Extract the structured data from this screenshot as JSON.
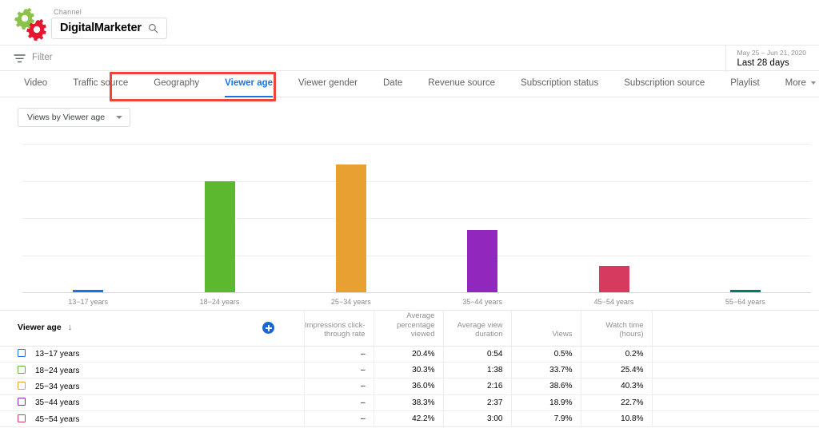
{
  "header": {
    "logo_icon": "gears-logo-icon",
    "logo_colors": {
      "gear_green": "#8bc34a",
      "gear_red": "#e3172f"
    },
    "channel_label": "Channel",
    "channel_name": "DigitalMarketer",
    "search_icon": "search-icon"
  },
  "filterbar": {
    "filter_icon": "filter-icon",
    "filter_placeholder": "Filter",
    "date_range": "May 25 – Jun 21, 2020",
    "date_preset": "Last 28 days"
  },
  "tabs": {
    "items": [
      {
        "label": "Video",
        "active": false
      },
      {
        "label": "Traffic source",
        "active": false
      },
      {
        "label": "Geography",
        "active": false
      },
      {
        "label": "Viewer age",
        "active": true
      },
      {
        "label": "Viewer gender",
        "active": false
      },
      {
        "label": "Date",
        "active": false
      },
      {
        "label": "Revenue source",
        "active": false
      },
      {
        "label": "Subscription status",
        "active": false
      },
      {
        "label": "Subscription source",
        "active": false
      },
      {
        "label": "Playlist",
        "active": false
      },
      {
        "label": "More",
        "active": false,
        "has_chevron": true
      }
    ],
    "highlight_color": "#f04438",
    "active_color": "#1a73e8"
  },
  "metric_selector": {
    "label": "Views by Viewer age",
    "chevron_icon": "chevron-down-icon"
  },
  "chart_data": {
    "type": "bar",
    "title": "Views by Viewer age",
    "xlabel": "",
    "ylabel": "",
    "grid": true,
    "legend": "none",
    "ylim": [
      0,
      45
    ],
    "categories": [
      "13−17 years",
      "18−24 years",
      "25−34 years",
      "35−44 years",
      "45−54 years",
      "55−64 years"
    ],
    "values": [
      0.5,
      33.7,
      38.6,
      18.9,
      7.9,
      0.6
    ],
    "colors": [
      "#1a73e8",
      "#5cb82e",
      "#e8a033",
      "#9127bd",
      "#d63a5e",
      "#00796b"
    ],
    "value_unit": "percent of views"
  },
  "table": {
    "columns": [
      {
        "key": "name",
        "label": "Viewer age",
        "sort_icon": "sort-desc-arrow"
      },
      {
        "key": "plus",
        "label": "",
        "icon": "add-metric-icon"
      },
      {
        "key": "ctr",
        "label": "Impressions click-through rate"
      },
      {
        "key": "apv",
        "label": "Average percentage viewed"
      },
      {
        "key": "avd",
        "label": "Average view duration"
      },
      {
        "key": "views",
        "label": "Views"
      },
      {
        "key": "watch",
        "label": "Watch time (hours)"
      },
      {
        "key": "pad",
        "label": ""
      }
    ],
    "rows": [
      {
        "color": "#1a73e8",
        "name": "13−17 years",
        "ctr": "–",
        "apv": "20.4%",
        "avd": "0:54",
        "views": "0.5%",
        "watch": "0.2%"
      },
      {
        "color": "#5cb82e",
        "name": "18−24 years",
        "ctr": "–",
        "apv": "30.3%",
        "avd": "1:38",
        "views": "33.7%",
        "watch": "25.4%"
      },
      {
        "color": "#e8a033",
        "name": "25−34 years",
        "ctr": "–",
        "apv": "36.0%",
        "avd": "2:16",
        "views": "38.6%",
        "watch": "40.3%"
      },
      {
        "color": "#9127bd",
        "name": "35−44 years",
        "ctr": "–",
        "apv": "38.3%",
        "avd": "2:37",
        "views": "18.9%",
        "watch": "22.7%"
      },
      {
        "color": "#d63a5e",
        "name": "45−54 years",
        "ctr": "–",
        "apv": "42.2%",
        "avd": "3:00",
        "views": "7.9%",
        "watch": "10.8%"
      }
    ]
  }
}
